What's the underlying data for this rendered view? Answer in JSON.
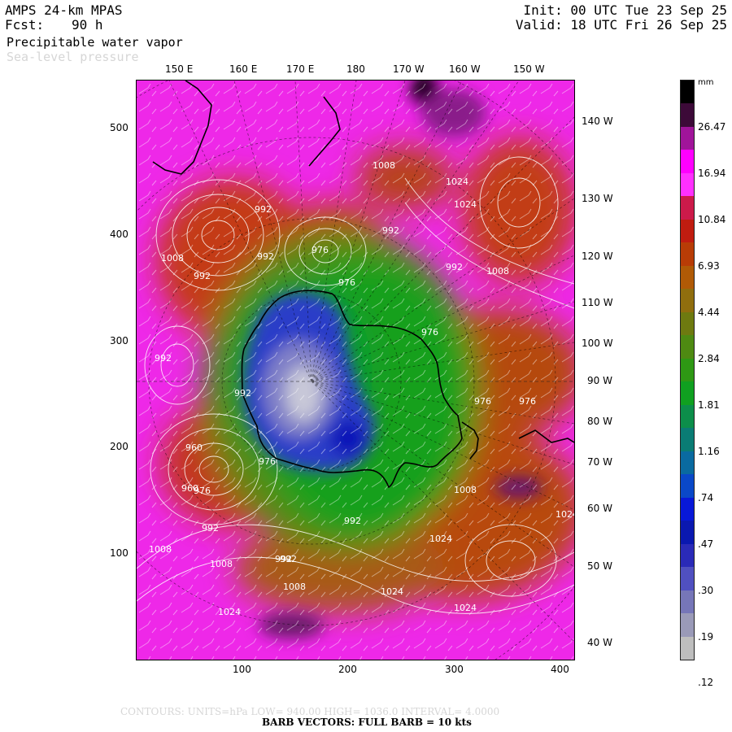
{
  "header": {
    "model": "AMPS 24-km MPAS",
    "fcst_label": "Fcst:",
    "fcst_value": "90 h",
    "init": "Init: 00 UTC Tue 23 Sep 25",
    "valid": "Valid: 18 UTC Fri 26 Sep 25",
    "field1": "Precipitable water vapor",
    "field2": "Sea-level pressure"
  },
  "top_lon_labels": [
    "150 E",
    "160 E",
    "170 E",
    "180",
    "170 W",
    "160 W",
    "150 W"
  ],
  "right_lon_labels": [
    "140 W",
    "130 W",
    "120 W",
    "110 W",
    "100 W",
    "90 W",
    "80 W",
    "70 W",
    "60 W",
    "50 W",
    "40 W"
  ],
  "y_ticks": [
    "500",
    "400",
    "300",
    "200",
    "100"
  ],
  "x_ticks": [
    "100",
    "200",
    "300",
    "400"
  ],
  "colorbar": {
    "unit": "mm",
    "labels": [
      "26.47",
      "16.94",
      "10.84",
      "6.93",
      "4.44",
      "2.84",
      "1.81",
      "1.16",
      ".74",
      ".47",
      ".30",
      ".19",
      ".12"
    ],
    "colors": [
      "#000000",
      "#3c0a38",
      "#a0149a",
      "#ff00ff",
      "#ff30ff",
      "#cc1a4a",
      "#c01c10",
      "#b83c06",
      "#b05a06",
      "#906e0e",
      "#6e7a10",
      "#4e8a12",
      "#2e9814",
      "#10a020",
      "#0c8e4a",
      "#0a7c74",
      "#0a6aa0",
      "#0a48c8",
      "#0818d8",
      "#0a18b0",
      "#2a2ab8",
      "#5050c0",
      "#7676b8",
      "#9a9ab8",
      "#bebebe"
    ]
  },
  "contour_labels": [
    "1008",
    "992",
    "1024",
    "1024",
    "992",
    "992",
    "1008",
    "976",
    "1008",
    "992",
    "992",
    "976",
    "992",
    "976",
    "976",
    "976",
    "992",
    "960",
    "960",
    "976",
    "992",
    "976",
    "1008",
    "992",
    "992",
    "1024",
    "1008",
    "1024",
    "1008",
    "992",
    "1008",
    "1024",
    "1024",
    "1024"
  ],
  "footer": {
    "contours": "CONTOURS:  UNITS=hPa  LOW=  940.00       HIGH=  1036.0       INTERVAL=     4.0000",
    "barbs": "BARB VECTORS:  FULL BARB = 10 kts"
  }
}
